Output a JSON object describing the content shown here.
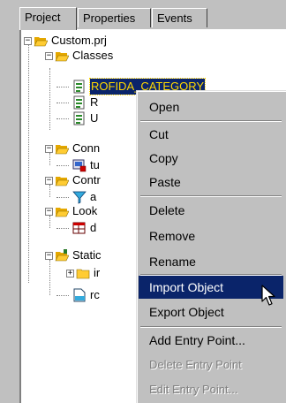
{
  "tabs": [
    {
      "label": "Project",
      "active": true
    },
    {
      "label": "Properties",
      "active": false
    },
    {
      "label": "Events",
      "active": false
    }
  ],
  "tree": {
    "root": "Custom.prj",
    "classes": {
      "label": "Classes",
      "items": [
        "ROFIDA_CATEGORY",
        "R",
        "U"
      ]
    },
    "connections": {
      "label": "Conn",
      "items": [
        "tu"
      ]
    },
    "controls": {
      "label": "Contr",
      "items": [
        "a"
      ]
    },
    "lookups": {
      "label": "Look",
      "items": [
        "d"
      ]
    },
    "static": {
      "label": "Static",
      "items": [
        "ir",
        "rc"
      ]
    }
  },
  "context_menu": {
    "items": [
      {
        "label": "Open",
        "enabled": true
      },
      {
        "label": "Cut",
        "enabled": true
      },
      {
        "label": "Copy",
        "enabled": true
      },
      {
        "label": "Paste",
        "enabled": true
      },
      {
        "label": "Delete",
        "enabled": true
      },
      {
        "label": "Remove",
        "enabled": true
      },
      {
        "label": "Rename",
        "enabled": true
      },
      {
        "label": "Import Object",
        "enabled": true,
        "highlighted": true
      },
      {
        "label": "Export Object",
        "enabled": true
      },
      {
        "label": "Add Entry Point...",
        "enabled": true
      },
      {
        "label": "Delete Entry Point",
        "enabled": false
      },
      {
        "label": "Edit Entry Point...",
        "enabled": false
      }
    ]
  },
  "colors": {
    "selection_bg": "#0a246a",
    "selection_text": "#ffd800",
    "folder": "#ffcc33",
    "face": "#c0c0c0"
  }
}
